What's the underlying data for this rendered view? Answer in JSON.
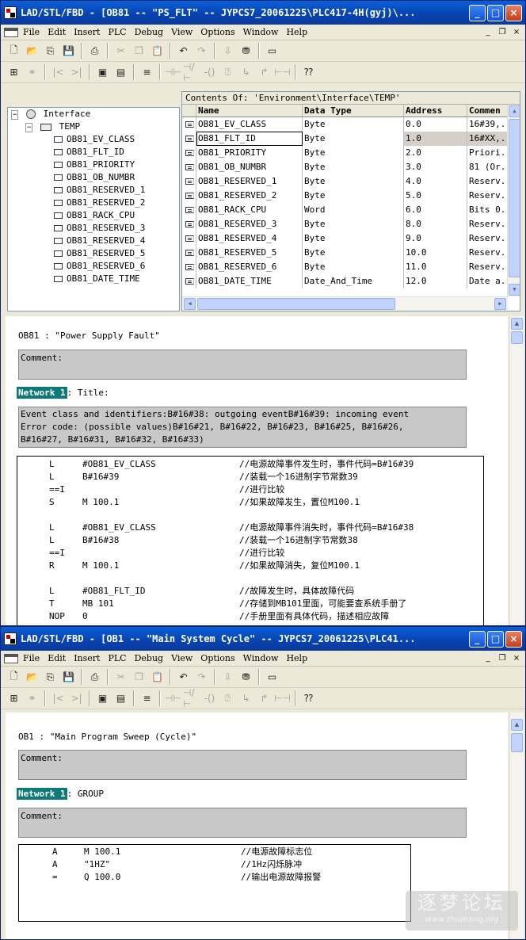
{
  "window1": {
    "title": "LAD/STL/FBD  - [OB81 -- \"PS_FLT\" -- JYPCS7_20061225\\PLC417-4H(gyj)\\...",
    "menu": [
      "File",
      "Edit",
      "Insert",
      "PLC",
      "Debug",
      "View",
      "Options",
      "Window",
      "Help"
    ],
    "tree": {
      "root": "Interface",
      "temp": "TEMP",
      "items": [
        "OB81_EV_CLASS",
        "OB81_FLT_ID",
        "OB81_PRIORITY",
        "OB81_OB_NUMBR",
        "OB81_RESERVED_1",
        "OB81_RESERVED_2",
        "OB81_RACK_CPU",
        "OB81_RESERVED_3",
        "OB81_RESERVED_4",
        "OB81_RESERVED_5",
        "OB81_RESERVED_6",
        "OB81_DATE_TIME"
      ]
    },
    "decl": {
      "header": "Contents Of: 'Environment\\Interface\\TEMP'",
      "columns": [
        "Name",
        "Data Type",
        "Address",
        "Commen"
      ],
      "rows": [
        {
          "name": "OB81_EV_CLASS",
          "type": "Byte",
          "addr": "0.0",
          "comment": "16#39,."
        },
        {
          "name": "OB81_FLT_ID",
          "type": "Byte",
          "addr": "1.0",
          "comment": "16#XX,."
        },
        {
          "name": "OB81_PRIORITY",
          "type": "Byte",
          "addr": "2.0",
          "comment": "Priori."
        },
        {
          "name": "OB81_OB_NUMBR",
          "type": "Byte",
          "addr": "3.0",
          "comment": "81 (Or."
        },
        {
          "name": "OB81_RESERVED_1",
          "type": "Byte",
          "addr": "4.0",
          "comment": "Reserv."
        },
        {
          "name": "OB81_RESERVED_2",
          "type": "Byte",
          "addr": "5.0",
          "comment": "Reserv."
        },
        {
          "name": "OB81_RACK_CPU",
          "type": "Word",
          "addr": "6.0",
          "comment": "Bits 0."
        },
        {
          "name": "OB81_RESERVED_3",
          "type": "Byte",
          "addr": "8.0",
          "comment": "Reserv."
        },
        {
          "name": "OB81_RESERVED_4",
          "type": "Byte",
          "addr": "9.0",
          "comment": "Reserv."
        },
        {
          "name": "OB81_RESERVED_5",
          "type": "Byte",
          "addr": "10.0",
          "comment": "Reserv."
        },
        {
          "name": "OB81_RESERVED_6",
          "type": "Byte",
          "addr": "11.0",
          "comment": "Reserv."
        },
        {
          "name": "OB81_DATE_TIME",
          "type": "Date_And_Time",
          "addr": "12.0",
          "comment": "Date a."
        }
      ]
    },
    "editor": {
      "block_title": "OB81 :  \"Power Supply Fault\"",
      "comment_label": "Comment:",
      "network_label": "Network 1",
      "network_title": ": Title:",
      "network_comment": [
        "Event class and identifiers:B#16#38: outgoing eventB#16#39: incoming event",
        "Error code: (possible values)B#16#21, B#16#22, B#16#23, B#16#25, B#16#26,",
        "B#16#27, B#16#31, B#16#32, B#16#33)"
      ],
      "code": [
        {
          "op": "L",
          "arg": "#OB81_EV_CLASS",
          "cm": "//电源故障事件发生时，事件代码=B#16#39"
        },
        {
          "op": "L",
          "arg": "B#16#39",
          "cm": "//装载一个16进制字节常数39"
        },
        {
          "op": "==I",
          "arg": "",
          "cm": "//进行比较"
        },
        {
          "op": "S",
          "arg": "M     100.1",
          "cm": "//如果故障发生，置位M100.1"
        },
        {
          "op": "",
          "arg": "",
          "cm": ""
        },
        {
          "op": "L",
          "arg": "#OB81_EV_CLASS",
          "cm": "//电源故障事件消失时，事件代码=B#16#38"
        },
        {
          "op": "L",
          "arg": "B#16#38",
          "cm": "//装载一个16进制字节常数38"
        },
        {
          "op": "==I",
          "arg": "",
          "cm": "//进行比较"
        },
        {
          "op": "R",
          "arg": "M     100.1",
          "cm": "//如果故障消失，复位M100.1"
        },
        {
          "op": "",
          "arg": "",
          "cm": ""
        },
        {
          "op": "L",
          "arg": "#OB81_FLT_ID",
          "cm": "//故障发生时，具体故障代码"
        },
        {
          "op": "T",
          "arg": "MB    101",
          "cm": "//存储到MB101里面，可能要查系统手册了"
        },
        {
          "op": "NOP",
          "arg": "0",
          "cm": "//手册里面有具体代码，描述相应故障"
        }
      ]
    }
  },
  "window2": {
    "title": "LAD/STL/FBD  - [OB1 -- \"Main System Cycle\" -- JYPCS7_20061225\\PLC41...",
    "menu": [
      "File",
      "Edit",
      "Insert",
      "PLC",
      "Debug",
      "View",
      "Options",
      "Window",
      "Help"
    ],
    "editor": {
      "block_title": "OB1 :  \"Main Program Sweep (Cycle)\"",
      "comment_label": "Comment:",
      "network_label": "Network 1",
      "network_title": ": GROUP",
      "network_comment_label": "Comment:",
      "code": [
        {
          "op": "A",
          "arg": "M     100.1",
          "cm": "//电源故障标志位"
        },
        {
          "op": "A",
          "arg": "\"1HZ\"",
          "cm": "//1Hz闪烁脉冲"
        },
        {
          "op": "=",
          "arg": "Q     100.0",
          "cm": "//输出电源故障报警"
        }
      ]
    }
  },
  "watermark": {
    "cn": "逐梦论坛",
    "url": "www.zhumeng.org"
  },
  "colors": {
    "titlebar": "#0a4fc8",
    "network_label": "#0e7a78",
    "comment_bg": "#c8c8c8",
    "window_bg": "#ece9d8"
  }
}
